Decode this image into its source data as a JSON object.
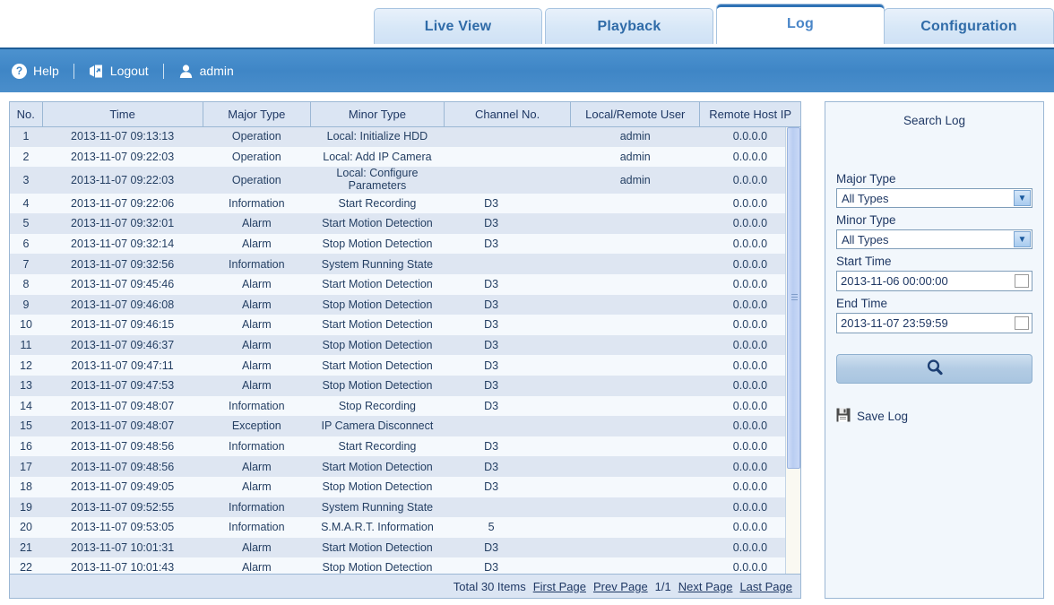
{
  "tabs": [
    {
      "id": "live",
      "label": "Live View",
      "active": false
    },
    {
      "id": "playback",
      "label": "Playback",
      "active": false
    },
    {
      "id": "log",
      "label": "Log",
      "active": true
    },
    {
      "id": "config",
      "label": "Configuration",
      "active": false
    }
  ],
  "toolbar": {
    "help_label": "Help",
    "help_icon": "question-mark-icon",
    "logout_label": "Logout",
    "logout_icon": "logout-icon",
    "user_label": "admin",
    "user_icon": "user-icon"
  },
  "table": {
    "columns": [
      "No.",
      "Time",
      "Major Type",
      "Minor Type",
      "Channel No.",
      "Local/Remote User",
      "Remote Host IP"
    ],
    "rows": [
      [
        "1",
        "2013-11-07 09:13:13",
        "Operation",
        "Local: Initialize HDD",
        "",
        "admin",
        "0.0.0.0"
      ],
      [
        "2",
        "2013-11-07 09:22:03",
        "Operation",
        "Local: Add IP Camera",
        "",
        "admin",
        "0.0.0.0"
      ],
      [
        "3",
        "2013-11-07 09:22:03",
        "Operation",
        "Local: Configure Parameters",
        "",
        "admin",
        "0.0.0.0"
      ],
      [
        "4",
        "2013-11-07 09:22:06",
        "Information",
        "Start Recording",
        "D3",
        "",
        "0.0.0.0"
      ],
      [
        "5",
        "2013-11-07 09:32:01",
        "Alarm",
        "Start Motion Detection",
        "D3",
        "",
        "0.0.0.0"
      ],
      [
        "6",
        "2013-11-07 09:32:14",
        "Alarm",
        "Stop Motion Detection",
        "D3",
        "",
        "0.0.0.0"
      ],
      [
        "7",
        "2013-11-07 09:32:56",
        "Information",
        "System Running State",
        "",
        "",
        "0.0.0.0"
      ],
      [
        "8",
        "2013-11-07 09:45:46",
        "Alarm",
        "Start Motion Detection",
        "D3",
        "",
        "0.0.0.0"
      ],
      [
        "9",
        "2013-11-07 09:46:08",
        "Alarm",
        "Stop Motion Detection",
        "D3",
        "",
        "0.0.0.0"
      ],
      [
        "10",
        "2013-11-07 09:46:15",
        "Alarm",
        "Start Motion Detection",
        "D3",
        "",
        "0.0.0.0"
      ],
      [
        "11",
        "2013-11-07 09:46:37",
        "Alarm",
        "Stop Motion Detection",
        "D3",
        "",
        "0.0.0.0"
      ],
      [
        "12",
        "2013-11-07 09:47:11",
        "Alarm",
        "Start Motion Detection",
        "D3",
        "",
        "0.0.0.0"
      ],
      [
        "13",
        "2013-11-07 09:47:53",
        "Alarm",
        "Stop Motion Detection",
        "D3",
        "",
        "0.0.0.0"
      ],
      [
        "14",
        "2013-11-07 09:48:07",
        "Information",
        "Stop Recording",
        "D3",
        "",
        "0.0.0.0"
      ],
      [
        "15",
        "2013-11-07 09:48:07",
        "Exception",
        "IP Camera Disconnect",
        "",
        "",
        "0.0.0.0"
      ],
      [
        "16",
        "2013-11-07 09:48:56",
        "Information",
        "Start Recording",
        "D3",
        "",
        "0.0.0.0"
      ],
      [
        "17",
        "2013-11-07 09:48:56",
        "Alarm",
        "Start Motion Detection",
        "D3",
        "",
        "0.0.0.0"
      ],
      [
        "18",
        "2013-11-07 09:49:05",
        "Alarm",
        "Stop Motion Detection",
        "D3",
        "",
        "0.0.0.0"
      ],
      [
        "19",
        "2013-11-07 09:52:55",
        "Information",
        "System Running State",
        "",
        "",
        "0.0.0.0"
      ],
      [
        "20",
        "2013-11-07 09:53:05",
        "Information",
        "S.M.A.R.T. Information",
        "5",
        "",
        "0.0.0.0"
      ],
      [
        "21",
        "2013-11-07 10:01:31",
        "Alarm",
        "Start Motion Detection",
        "D3",
        "",
        "0.0.0.0"
      ],
      [
        "22",
        "2013-11-07 10:01:43",
        "Alarm",
        "Stop Motion Detection",
        "D3",
        "",
        "0.0.0.0"
      ]
    ],
    "row3_line1": "Local: Configure",
    "row3_line2": "Parameters"
  },
  "pager": {
    "total": "Total 30 Items",
    "first_page": "First Page",
    "prev_page": "Prev Page",
    "page_indicator": "1/1",
    "next_page": "Next Page",
    "last_page": "Last Page"
  },
  "search": {
    "title": "Search Log",
    "major_type_label": "Major Type",
    "major_type_value": "All Types",
    "minor_type_label": "Minor Type",
    "minor_type_value": "All Types",
    "start_time_label": "Start Time",
    "start_time_value": "2013-11-06 00:00:00",
    "end_time_label": "End Time",
    "end_time_value": "2013-11-07 23:59:59",
    "search_icon": "magnifier-icon",
    "calendar_icon": "calendar-icon",
    "save_log_label": "Save Log",
    "save_icon": "floppy-disk-icon"
  },
  "colors": {
    "header_blue": "#3f86c6",
    "table_header": "#dbe5f3",
    "row_odd": "#dee6f2",
    "row_even": "#f5f9fd",
    "text": "#1f3864",
    "tab_active_accent": "#2f72b5"
  }
}
